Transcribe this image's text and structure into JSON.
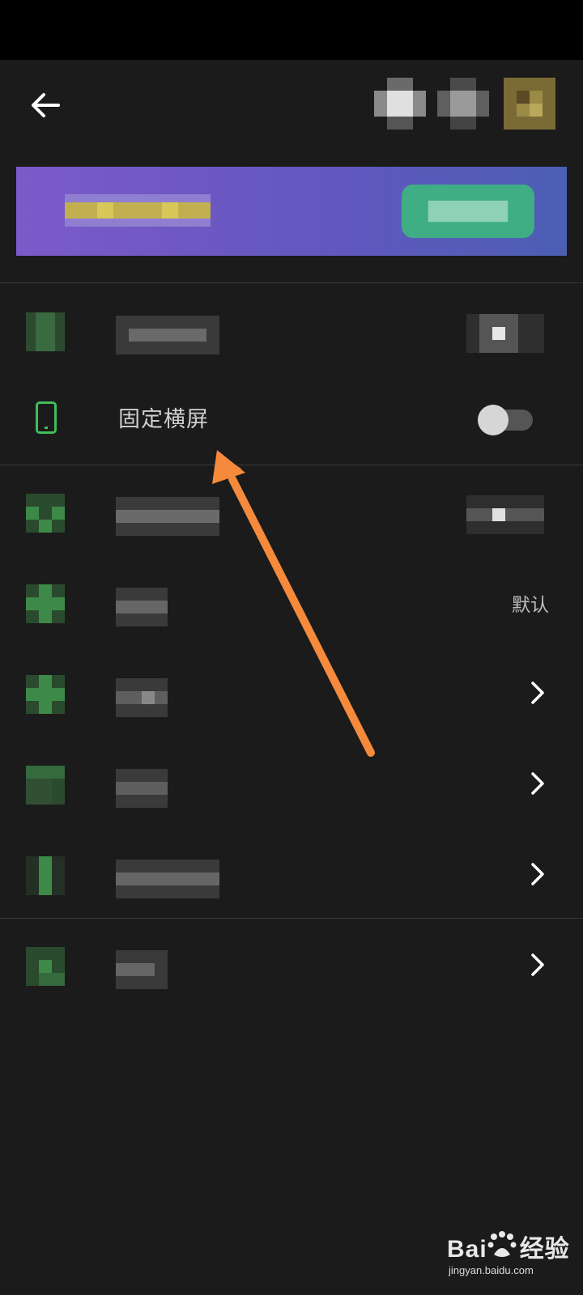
{
  "header": {
    "back_icon": "arrow-left-icon",
    "actions": [
      "blurred-action-icon",
      "blurred-action-icon",
      "blurred-avatar"
    ]
  },
  "rows": {
    "lock_landscape": {
      "icon": "phone-portrait-icon",
      "label": "固定横屏",
      "toggle_on": false
    },
    "default_value": "默认",
    "chevron_icon": "chevron-right-icon"
  },
  "annotation": {
    "arrow_color": "#f58a3c"
  },
  "watermark": {
    "brand": "Bai du 经验",
    "brand_left": "Bai",
    "brand_right": "经验",
    "url": "jingyan.baidu.com"
  },
  "colors": {
    "background": "#1b1b1b",
    "accent_green": "#3fbe5a",
    "banner_start": "#7c5ac9",
    "banner_end": "#4c5fb3",
    "banner_button": "#3fae84"
  }
}
